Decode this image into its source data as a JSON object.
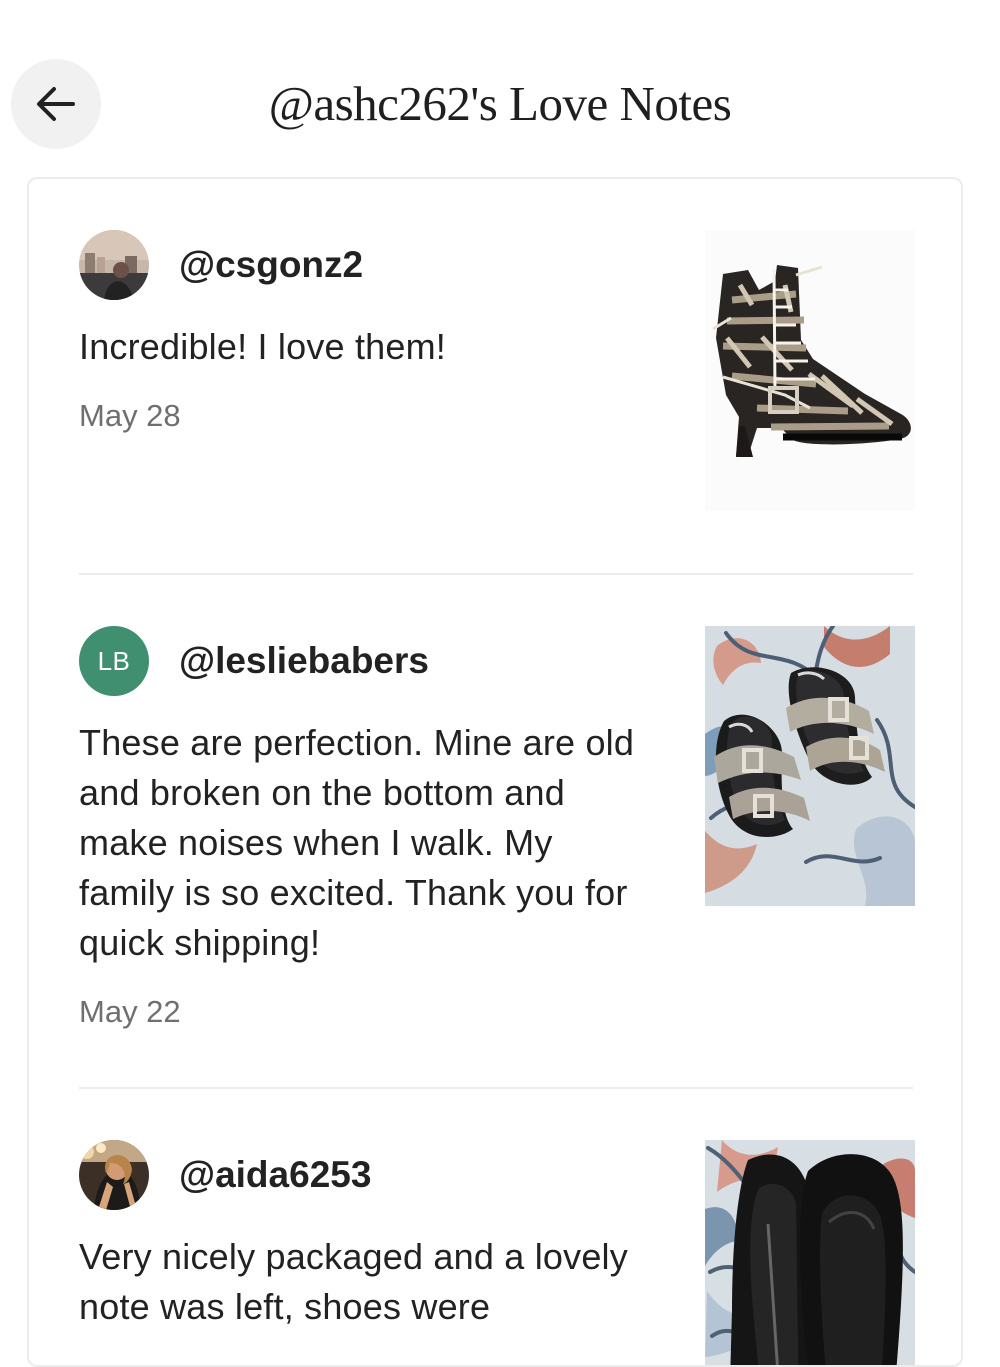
{
  "header": {
    "title": "@ashc262's Love Notes",
    "back_icon": "arrow-left-icon"
  },
  "notes": [
    {
      "username": "@csgonz2",
      "avatar_type": "photo",
      "text": "Incredible! I love them!",
      "date": "May 28",
      "product_image": "snakeskin-lace-up-ankle-boot"
    },
    {
      "username": "@lesliebabers",
      "avatar_type": "initials",
      "avatar_initials": "LB",
      "avatar_color": "#3f8f70",
      "text": "These are perfection. Mine are old and broken on the bottom and make noises when I walk. My family is so excited. Thank you for quick shipping!",
      "date": "May 22",
      "product_image": "embellished-buckle-sandals-on-rug"
    },
    {
      "username": "@aida6253",
      "avatar_type": "photo",
      "text": "Very nicely packaged and a lovely note was left, shoes were",
      "product_image": "black-velvet-loafers-on-rug"
    }
  ]
}
